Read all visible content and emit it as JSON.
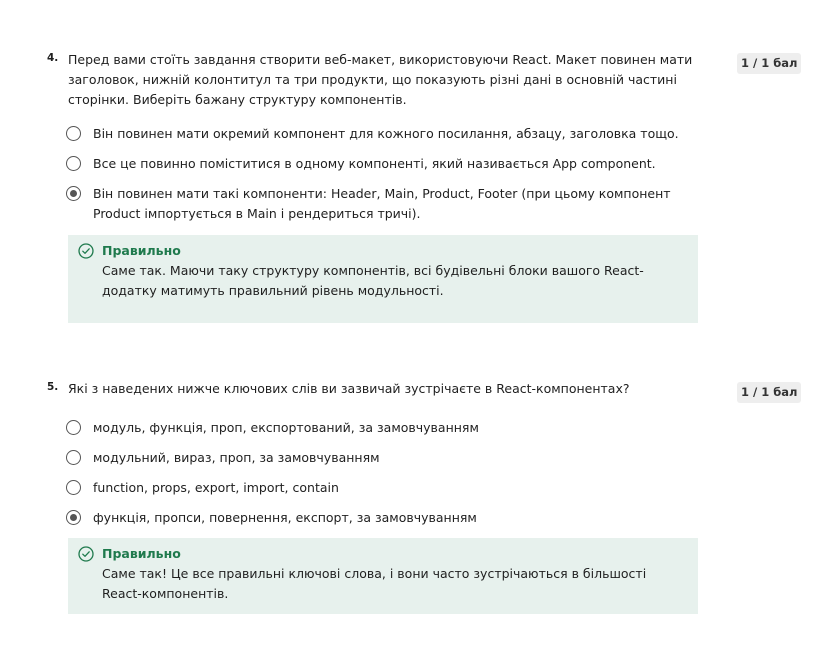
{
  "questions": [
    {
      "number": "4.",
      "text": "Перед вами стоїть завдання створити веб-макет, використовуючи React. Макет повинен мати заголовок, нижній колонтитул та три продукти, що показують різні дані в основній частині сторінки. Виберіть бажану структуру компонентів.",
      "score": "1 / 1 бал",
      "options": [
        {
          "label": "Він повинен мати окремий компонент для кожного посилання, абзацу, заголовка тощо.",
          "selected": false
        },
        {
          "label": "Все це повинно поміститися в одному компоненті, який називається App component.",
          "selected": false
        },
        {
          "label": "Він повинен мати такі компоненти: Header, Main, Product, Footer (при цьому компонент Product імпортується в Main і рендериться тричі).",
          "selected": true
        }
      ],
      "feedback": {
        "icon": "check-circle-icon",
        "title": "Правильно",
        "text": "Саме так. Маючи таку структуру компонентів, всі будівельні блоки вашого React-додатку матимуть правильний рівень модульності."
      }
    },
    {
      "number": "5.",
      "text": "Які з наведених нижче ключових слів ви зазвичай зустрічаєте в React-компонентах?",
      "score": "1 / 1 бал",
      "options": [
        {
          "label": "модуль, функція, проп, експортований, за замовчуванням",
          "selected": false
        },
        {
          "label": "модульний, вираз, проп, за замовчуванням",
          "selected": false
        },
        {
          "label": "function, props, export, import, contain",
          "selected": false
        },
        {
          "label": "функція, пропси, повернення, експорт, за замовчуванням",
          "selected": true
        }
      ],
      "feedback": {
        "icon": "check-circle-icon",
        "title": "Правильно",
        "text": "Саме так! Це все правильні ключові слова, і вони часто зустрічаються в більшості React-компонентів."
      }
    }
  ],
  "colors": {
    "correct_accent": "#1f7a4d",
    "feedback_bg": "#e7f1ed",
    "score_bg": "#eeeeee"
  }
}
